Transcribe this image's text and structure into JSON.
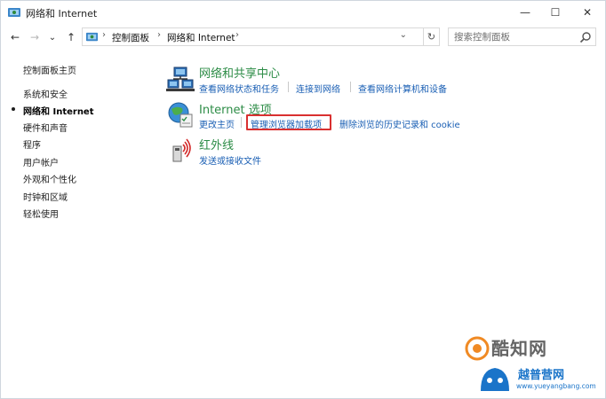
{
  "window": {
    "title": "网络和 Internet",
    "minimize_glyph": "—",
    "maximize_glyph": "☐",
    "close_glyph": "✕"
  },
  "nav": {
    "back_glyph": "←",
    "forward_glyph": "→",
    "recent_glyph": "⌄",
    "up_glyph": "↑",
    "dropdown_glyph": "⌄",
    "refresh_glyph": "↻"
  },
  "breadcrumb": {
    "items": [
      "控制面板",
      "网络和 Internet"
    ],
    "separator": "›"
  },
  "search": {
    "placeholder": "搜索控制面板"
  },
  "sidebar": {
    "items": [
      {
        "label": "控制面板主页"
      },
      {
        "label": "系统和安全"
      },
      {
        "label": "网络和 Internet"
      },
      {
        "label": "硬件和声音"
      },
      {
        "label": "程序"
      },
      {
        "label": "用户帐户"
      },
      {
        "label": "外观和个性化"
      },
      {
        "label": "时钟和区域"
      },
      {
        "label": "轻松使用"
      }
    ],
    "current_index": 2
  },
  "categories": [
    {
      "title": "网络和共享中心",
      "icon": "network-sharing-icon",
      "links": [
        "查看网络状态和任务",
        "连接到网络",
        "查看网络计算机和设备"
      ]
    },
    {
      "title": "Internet 选项",
      "icon": "internet-options-icon",
      "links": [
        "更改主页",
        "管理浏览器加载项",
        "删除浏览的历史记录和 cookie"
      ]
    },
    {
      "title": "红外线",
      "icon": "infrared-icon",
      "links": [
        "发送或接收文件"
      ]
    }
  ],
  "watermarks": {
    "wm1": "酷知网",
    "wm2": "越普营网",
    "wm2_url": "www.yueyangbang.com"
  },
  "colors": {
    "link": "#1a5fb4",
    "category_title": "#2c8c46",
    "highlight": "#d93030"
  }
}
